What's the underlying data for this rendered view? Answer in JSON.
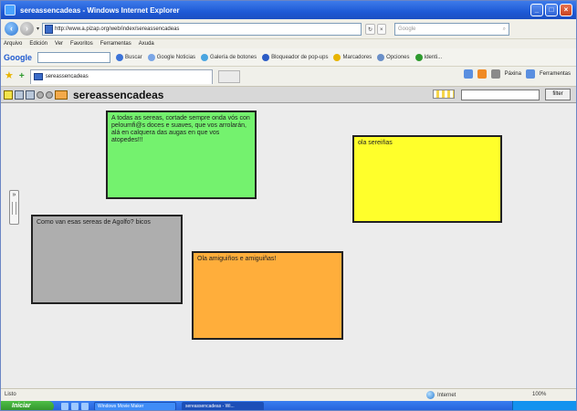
{
  "window": {
    "title": "sereassencadeas - Windows Internet Explorer"
  },
  "address": {
    "url": "http://www.a.pizap.org/web/index/sereassencadeas",
    "search_placeholder": "Google"
  },
  "menu": [
    "Arquivo",
    "Edición",
    "Ver",
    "Favoritos",
    "Ferramentas",
    "Axuda"
  ],
  "google_toolbar": {
    "label": "Google",
    "items": [
      "Buscar",
      "Google Noticias",
      "Galería de botones",
      "Bloqueador de pop-ups",
      "Marcadores",
      "Opciones",
      "Identi..."
    ]
  },
  "tabs": {
    "active_label": "sereassencadeas"
  },
  "command_bar": [
    "Páxina",
    "Ferramentas"
  ],
  "app": {
    "title": "sereassencadeas",
    "filter_button": "filter"
  },
  "notes": [
    {
      "color": "#74f26e",
      "text": "A todas as sereas, cortade sempre onda vós con peloumfi@s doces e suaves, que vos arrolarán, alá en calquera das augas en que vos atopedes!!!"
    },
    {
      "color": "#ffff2b",
      "text": "ola sereiñas"
    },
    {
      "color": "#aeaeae",
      "text": "Como van esas sereas de Agolfo? bicos"
    },
    {
      "color": "#ffae3b",
      "text": "Ola amiguiños e amiguiñas!"
    }
  ],
  "status": {
    "left": "Listo",
    "zone": "Internet",
    "zoom": "100%"
  },
  "taskbar": {
    "start": "Iniciar",
    "tasks": [
      "Windows Movie Maker",
      "sereassencadeas - Wi..."
    ]
  }
}
